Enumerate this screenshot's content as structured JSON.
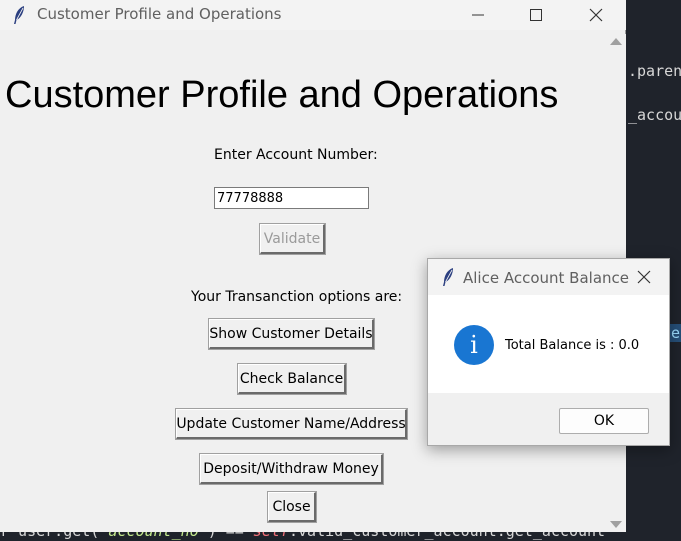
{
  "editor": {
    "line1": ".paren",
    "line2": "_accou",
    "line3": "e",
    "bottom_prefix": "r user.get(",
    "bottom_arg": "'account_no'",
    "bottom_mid": ") ==",
    "bottom_self": "self",
    "bottom_suffix": ".valid_customer_account.get_account"
  },
  "main_window": {
    "title": "Customer Profile and Operations",
    "heading": "Customer Profile and Operations",
    "account_label": "Enter Account Number:",
    "account_value": "77778888",
    "validate_label": "Validate",
    "options_label": "Your Transanction options are:",
    "buttons": {
      "details": "Show Customer Details",
      "balance": "Check Balance",
      "update": "Update Customer Name/Address",
      "deposit": "Deposit/Withdraw Money",
      "close": "Close"
    }
  },
  "dialog": {
    "title": "Alice Account Balance",
    "message": "Total Balance is : 0.0",
    "info_glyph": "i",
    "ok_label": "OK"
  },
  "icons": {
    "app_icon": "feather-icon",
    "minimize": "minimize-icon",
    "maximize": "maximize-icon",
    "close": "close-icon",
    "info": "info-icon"
  },
  "colors": {
    "info_blue": "#1976d2",
    "editor_bg": "#1f232b",
    "window_bg": "#f0f0f0"
  }
}
